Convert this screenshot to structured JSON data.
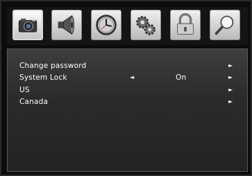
{
  "tabs": [
    {
      "icon": "camera-icon",
      "active": true
    },
    {
      "icon": "speaker-icon",
      "active": false
    },
    {
      "icon": "clock-icon",
      "active": false
    },
    {
      "icon": "gears-icon",
      "active": false
    },
    {
      "icon": "lock-icon",
      "active": false
    },
    {
      "icon": "magnifier-icon",
      "active": false
    }
  ],
  "menu": {
    "items": [
      {
        "label": "Change password",
        "value": "",
        "right_arrow": "►"
      },
      {
        "label": "System Lock",
        "value": "On",
        "left_arrow": "◄",
        "right_arrow": "►"
      },
      {
        "label": "US",
        "value": "",
        "right_arrow": "►"
      },
      {
        "label": "Canada",
        "value": "",
        "right_arrow": "►"
      }
    ]
  },
  "colors": {
    "background": "#0c0c0c",
    "panel": "#2f2f2f",
    "text": "#ffffff"
  }
}
